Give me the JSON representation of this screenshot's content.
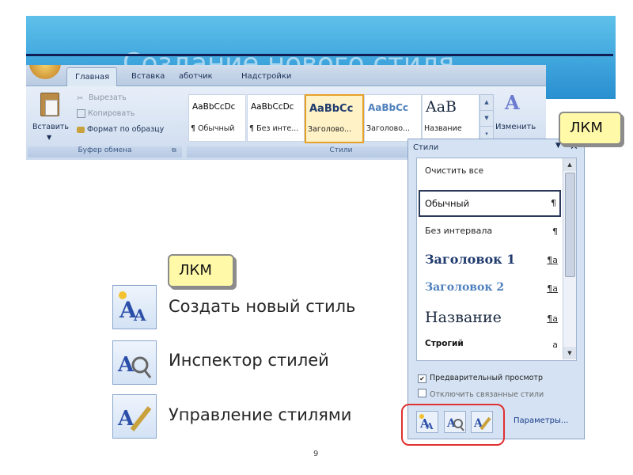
{
  "slide": {
    "title": "Создание нового стиля",
    "page_number": "9"
  },
  "ribbon": {
    "tabs": [
      "Главная",
      "Вставка",
      "аботчик",
      "Надстройки"
    ],
    "clipboard": {
      "paste_label": "Вставить",
      "cut_label": "Вырезать",
      "copy_label": "Копировать",
      "format_painter_label": "Формат по образцу",
      "group_label": "Буфер обмена"
    },
    "styles": {
      "gallery": [
        {
          "sample": "AaBbCcDc",
          "label": "¶ Обычный"
        },
        {
          "sample": "AaBbCcDc",
          "label": "¶ Без инте..."
        },
        {
          "sample": "AaBbCc",
          "label": "Заголово..."
        },
        {
          "sample": "AaBbCc",
          "label": "Заголово..."
        },
        {
          "sample": "AaB",
          "label": "Название"
        }
      ],
      "group_label": "Стили",
      "change_label": "Изменить"
    }
  },
  "styles_pane": {
    "title": "Стили",
    "items": [
      {
        "name": "Очистить все",
        "mark": ""
      },
      {
        "name": "Обычный",
        "mark": "¶"
      },
      {
        "name": "Без интервала",
        "mark": "¶"
      },
      {
        "name": "Заголовок 1",
        "mark": "¶a"
      },
      {
        "name": "Заголовок 2",
        "mark": "¶a"
      },
      {
        "name": "Название",
        "mark": "¶a"
      },
      {
        "name": "Строгий",
        "mark": "a"
      }
    ],
    "preview_label": "Предварительный просмотр",
    "preview_checked": true,
    "disable_linked_label": "Отключить связанные стили",
    "disable_linked_checked": false,
    "params_label": "Параметры..."
  },
  "callouts": {
    "top": "ЛКМ",
    "middle": "ЛКМ"
  },
  "features": [
    {
      "label": "Создать новый стиль",
      "icon": "new-style-icon"
    },
    {
      "label": "Инспектор стилей",
      "icon": "style-inspector-icon"
    },
    {
      "label": "Управление стилями",
      "icon": "manage-styles-icon"
    }
  ],
  "colors": {
    "header_blue": "#3fa5dd",
    "highlight_red": "#e03030",
    "callout_yellow": "#fff9a8"
  }
}
